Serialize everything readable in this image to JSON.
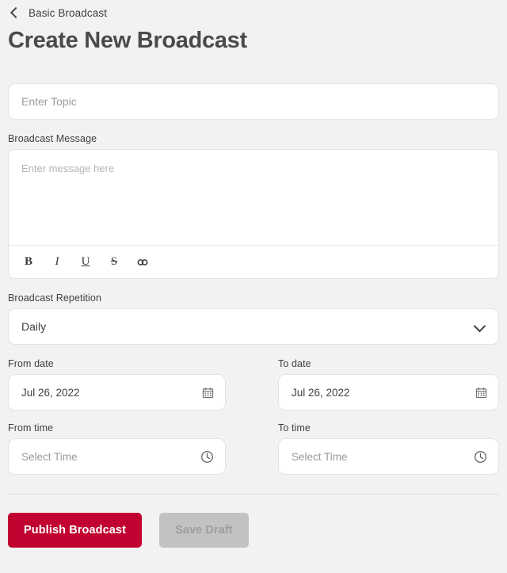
{
  "header": {
    "back_icon": "chevron-left-icon",
    "breadcrumb": "Basic Broadcast",
    "title": "Create New Broadcast"
  },
  "form": {
    "topic": {
      "label": ".",
      "placeholder": "Enter Topic",
      "value": ""
    },
    "message": {
      "label": "Broadcast Message",
      "placeholder": "Enter message here",
      "value": "",
      "toolbar": [
        {
          "name": "bold-icon",
          "glyph": "B"
        },
        {
          "name": "italic-icon",
          "glyph": "I"
        },
        {
          "name": "underline-icon",
          "glyph": "U"
        },
        {
          "name": "strikethrough-icon",
          "glyph": "S"
        },
        {
          "name": "link-icon",
          "glyph": ""
        }
      ]
    },
    "repetition": {
      "label": "Broadcast Repetition",
      "value": "Daily",
      "chevron_icon": "chevron-down-icon"
    },
    "from_date": {
      "label": "From date",
      "value": "Jul 26, 2022",
      "icon": "calendar-icon"
    },
    "to_date": {
      "label": "To date",
      "value": "Jul 26, 2022",
      "icon": "calendar-icon"
    },
    "from_time": {
      "label": "From time",
      "placeholder": "Select Time",
      "value": "Select Time",
      "icon": "clock-icon"
    },
    "to_time": {
      "label": "To time",
      "placeholder": "Select Time",
      "value": "Select Time",
      "icon": "clock-icon"
    }
  },
  "footer": {
    "publish_label": "Publish Broadcast",
    "save_draft_label": "Save Draft"
  },
  "colors": {
    "primary": "#c10230",
    "disabled": "#c2c2c2",
    "background": "#f2f2f2",
    "surface": "#ffffff",
    "text": "#3f3f3f",
    "placeholder": "#9a9a9a"
  }
}
